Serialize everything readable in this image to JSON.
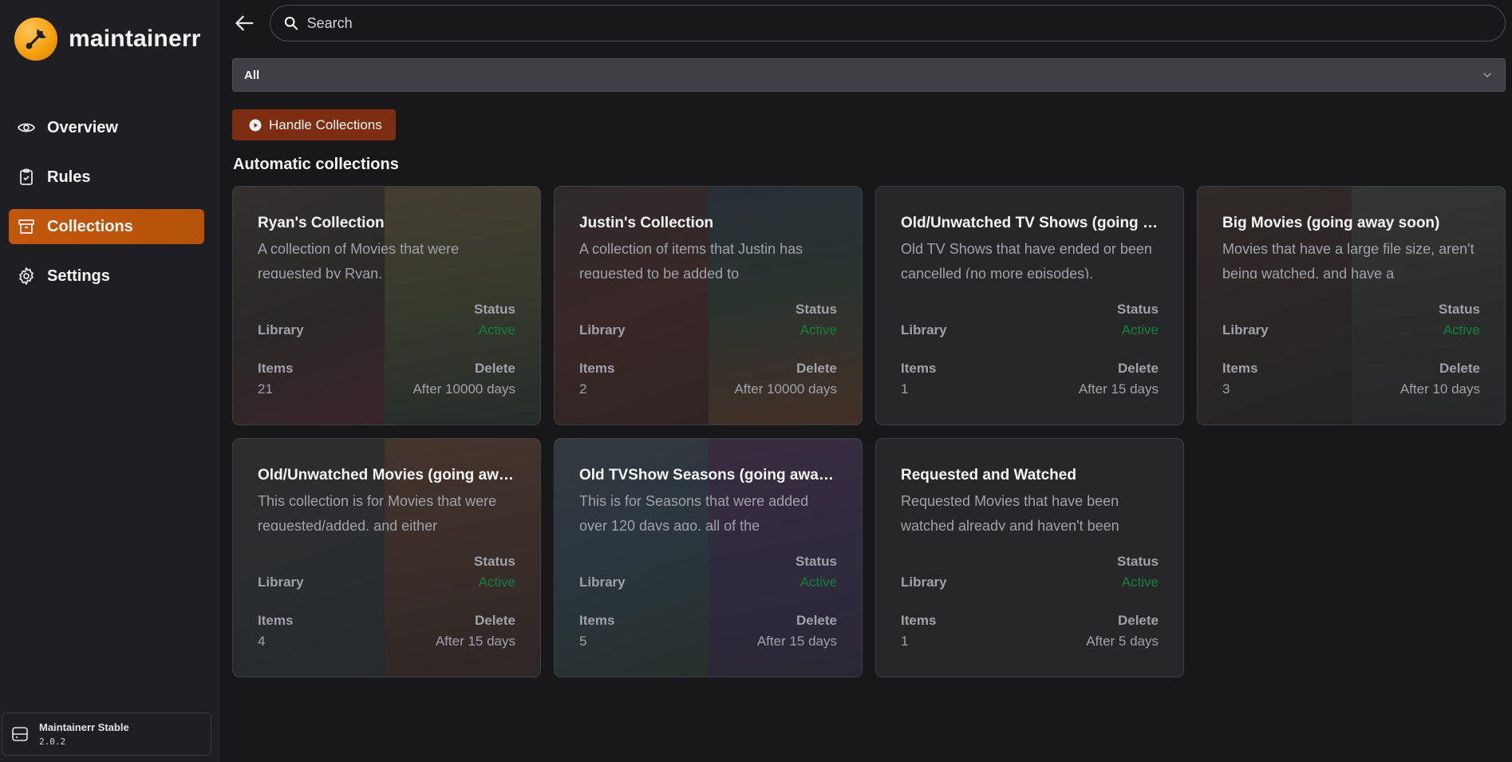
{
  "brand": {
    "name": "maintainerr"
  },
  "sidebar": {
    "items": [
      {
        "label": "Overview",
        "icon": "eye-icon"
      },
      {
        "label": "Rules",
        "icon": "clipboard-check-icon"
      },
      {
        "label": "Collections",
        "icon": "archive-box-icon",
        "active": true
      },
      {
        "label": "Settings",
        "icon": "gear-icon"
      }
    ],
    "version": {
      "title": "Maintainerr Stable",
      "number": "2.0.2"
    }
  },
  "search": {
    "placeholder": "Search"
  },
  "filter": {
    "selected": "All"
  },
  "actions": {
    "handle_label": "Handle Collections"
  },
  "section": {
    "title": "Automatic collections"
  },
  "labels": {
    "status": "Status",
    "library": "Library",
    "items": "Items",
    "delete": "Delete"
  },
  "collections": [
    {
      "title": "Ryan's Collection",
      "description": "A collection of Movies that were requested by Ryan.",
      "status": "Active",
      "items": "21",
      "delete": "After 10000 days"
    },
    {
      "title": "Justin's Collection",
      "description": "A collection of items that Justin has requested to be added to",
      "status": "Active",
      "items": "2",
      "delete": "After 10000 days"
    },
    {
      "title": "Old/Unwatched TV Shows (going away soon)",
      "description": "Old TV Shows that have ended or been cancelled (no more episodes).",
      "status": "Active",
      "items": "1",
      "delete": "After 15 days"
    },
    {
      "title": "Big Movies (going away soon)",
      "description": "Movies that have a large file size, aren't being watched, and have a",
      "status": "Active",
      "items": "3",
      "delete": "After 10 days"
    },
    {
      "title": "Old/Unwatched Movies (going away soon)",
      "description": "This collection is for Movies that were requested/added, and either",
      "status": "Active",
      "items": "4",
      "delete": "After 15 days"
    },
    {
      "title": "Old TVShow Seasons (going away soon)",
      "description": "This is for Seasons that were added over 120 days ago, all of the",
      "status": "Active",
      "items": "5",
      "delete": "After 15 days"
    },
    {
      "title": "Requested and Watched",
      "description": "Requested Movies that have been watched already and haven't been",
      "status": "Active",
      "items": "1",
      "delete": "After 5 days"
    }
  ],
  "colors": {
    "accent": "#c2570c",
    "handle_button": "#7c2d12",
    "status_active": "#15803d",
    "background": "#18181b"
  }
}
